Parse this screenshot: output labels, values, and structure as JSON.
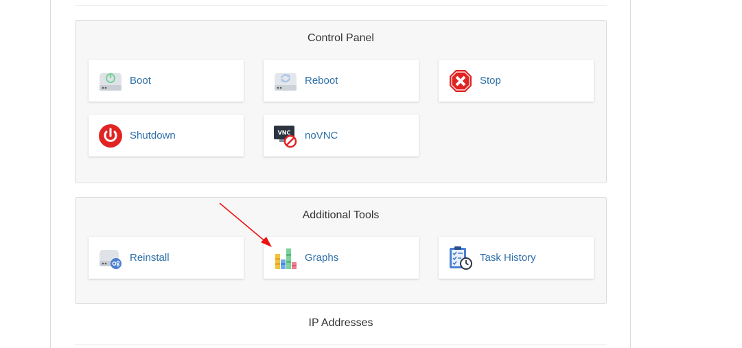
{
  "control_panel": {
    "title": "Control Panel",
    "tiles": [
      {
        "label": "Boot",
        "icon": "power-drive-icon"
      },
      {
        "label": "Reboot",
        "icon": "refresh-drive-icon"
      },
      {
        "label": "Stop",
        "icon": "stop-icon"
      },
      {
        "label": "Shutdown",
        "icon": "power-button-icon"
      },
      {
        "label": "noVNC",
        "icon": "vnc-disabled-icon"
      }
    ]
  },
  "additional_tools": {
    "title": "Additional Tools",
    "tiles": [
      {
        "label": "Reinstall",
        "icon": "reinstall-drive-icon"
      },
      {
        "label": "Graphs",
        "icon": "bar-graph-icon"
      },
      {
        "label": "Task History",
        "icon": "task-clipboard-icon"
      }
    ]
  },
  "ip_section": {
    "title": "IP Addresses"
  },
  "colors": {
    "link": "#2d6ea8",
    "stop_red": "#e02424",
    "annotation_arrow": "#e11"
  }
}
